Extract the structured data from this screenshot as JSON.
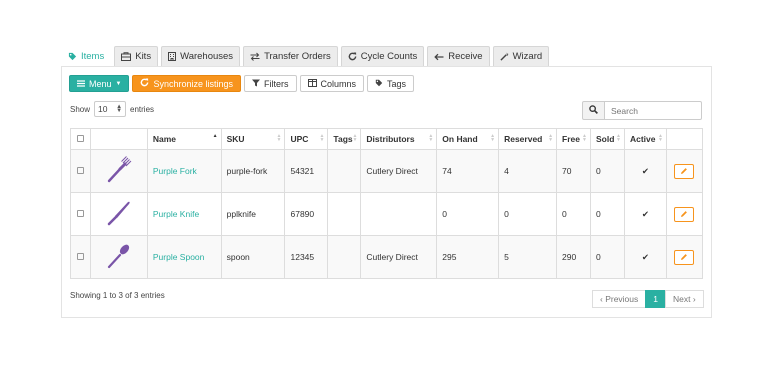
{
  "tabs": [
    {
      "label": "Items",
      "icon": "tag-icon",
      "active": true
    },
    {
      "label": "Kits",
      "icon": "kit-icon"
    },
    {
      "label": "Warehouses",
      "icon": "warehouse-icon"
    },
    {
      "label": "Transfer Orders",
      "icon": "transfer-icon"
    },
    {
      "label": "Cycle Counts",
      "icon": "refresh-icon"
    },
    {
      "label": "Receive",
      "icon": "arrow-left-icon"
    },
    {
      "label": "Wizard",
      "icon": "wand-icon"
    }
  ],
  "toolbar": {
    "menu_label": "Menu",
    "sync_label": "Synchronize listings",
    "filters_label": "Filters",
    "columns_label": "Columns",
    "tags_label": "Tags"
  },
  "length": {
    "show": "Show",
    "value": "10",
    "entries": "entries"
  },
  "search": {
    "placeholder": "Search"
  },
  "table": {
    "headers": [
      "Name",
      "SKU",
      "UPC",
      "Tags",
      "Distributors",
      "On Hand",
      "Reserved",
      "Free",
      "Sold",
      "Active"
    ],
    "rows": [
      {
        "image": "fork-icon",
        "name": "Purple Fork",
        "sku": "purple-fork",
        "upc": "54321",
        "tags": "",
        "distributors": "Cutlery Direct",
        "on_hand": "74",
        "reserved": "4",
        "free": "70",
        "sold": "0",
        "active": "✔"
      },
      {
        "image": "knife-icon",
        "name": "Purple Knife",
        "sku": "pplknife",
        "upc": "67890",
        "tags": "",
        "distributors": "",
        "on_hand": "0",
        "reserved": "0",
        "free": "0",
        "sold": "0",
        "active": "✔"
      },
      {
        "image": "spoon-icon",
        "name": "Purple Spoon",
        "sku": "spoon",
        "upc": "12345",
        "tags": "",
        "distributors": "Cutlery Direct",
        "on_hand": "295",
        "reserved": "5",
        "free": "290",
        "sold": "0",
        "active": "✔"
      }
    ]
  },
  "info": "Showing 1 to 3 of 3 entries",
  "pagination": {
    "previous": "‹ Previous",
    "current": "1",
    "next": "Next ›"
  },
  "colors": {
    "accent": "#2ab0a2",
    "orange": "#f7941d",
    "utensil": "#7a55a8"
  }
}
